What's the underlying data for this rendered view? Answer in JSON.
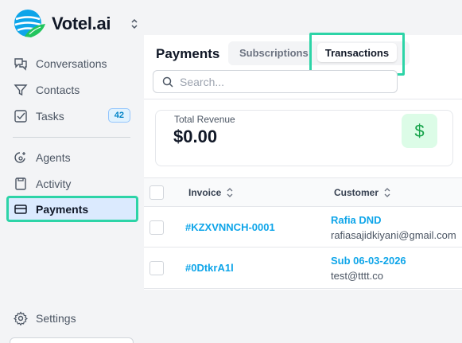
{
  "brand": {
    "name": "Votel.ai"
  },
  "sidebar": {
    "items": [
      {
        "label": "Conversations",
        "icon": "conversations-icon"
      },
      {
        "label": "Contacts",
        "icon": "filter-icon"
      },
      {
        "label": "Tasks",
        "icon": "checkbox-icon",
        "badge": "42"
      },
      {
        "label": "Agents",
        "icon": "agents-icon"
      },
      {
        "label": "Activity",
        "icon": "activity-icon"
      },
      {
        "label": "Payments",
        "icon": "card-icon",
        "active": true
      }
    ],
    "settings_label": "Settings"
  },
  "main": {
    "title": "Payments",
    "tabs": [
      {
        "label": "Subscriptions",
        "active": false
      },
      {
        "label": "Transactions",
        "active": true
      }
    ],
    "search": {
      "placeholder": "Search..."
    },
    "revenue": {
      "label": "Total Revenue",
      "value": "$0.00",
      "icon_symbol": "$"
    },
    "table": {
      "headers": {
        "invoice": "Invoice",
        "customer": "Customer"
      },
      "rows": [
        {
          "invoice": "#KZXVNNCH-0001",
          "customer_name": "Rafia DND",
          "customer_email": "rafiasajidkiyani@gmail.com"
        },
        {
          "invoice": "#0DtkrA1l",
          "customer_name": "Sub 06-03-2026",
          "customer_email": "test@tttt.co"
        }
      ]
    }
  },
  "colors": {
    "accent": "#0ea5e9",
    "highlight": "#2dd4a7",
    "revenue_green": "#16a34a"
  }
}
